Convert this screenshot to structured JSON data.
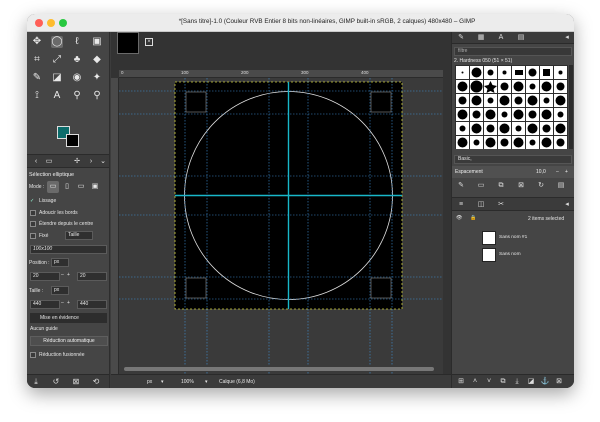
{
  "window": {
    "title": "*[Sans titre]-1.0 (Couleur RVB Entier 8 bits non-linéaires, GIMP built-in sRGB, 2 calques) 480x480 – GIMP"
  },
  "tool_options": {
    "title": "Sélection elliptique",
    "mode_label": "Mode :",
    "antialias_label": "Lissage",
    "feather_label": "Adoucir les bords",
    "expand_label": "Étendre depuis le centre",
    "fixed_label": "Fixé",
    "fixed_value": "Taille",
    "size_field": "100x100",
    "position_label": "Position :",
    "position_unit": "px",
    "pos_x": "20",
    "pos_y": "20",
    "size_label": "Taille :",
    "size_unit": "px",
    "size_w": "440",
    "size_h": "440",
    "highlight_label": "Mise en évidence",
    "guides_label": "Aucun guide",
    "auto_shrink_label": "Réduction automatique",
    "shrink_merged_label": "Réduction fusionnée"
  },
  "ruler": {
    "labels": [
      "0",
      "100",
      "200",
      "300",
      "400"
    ]
  },
  "status": {
    "unit": "px",
    "zoom": "100%",
    "layer_info": "Calque (6,8 Mo)"
  },
  "brushes": {
    "filter_placeholder": "filtre",
    "current_brush": "2. Hardness 050 (51 × 51)",
    "preset": "Basic,",
    "spacing_label": "Espacement",
    "spacing_value": "10,0"
  },
  "layers": {
    "selected_count": "2 items selected",
    "items": [
      {
        "name": "Sans nom #1"
      },
      {
        "name": "Sans nom"
      }
    ]
  },
  "colors": {
    "foreground": "#0c6c6b",
    "background": "#000000",
    "guide_cyan": "#18b7c9"
  }
}
